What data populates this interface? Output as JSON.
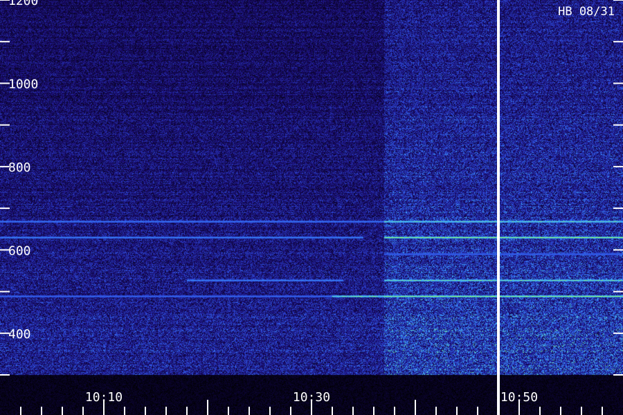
{
  "station_label": "HB 08/31",
  "colors": {
    "background": "#000000",
    "low": "#1a0a6e",
    "mid": "#2e4de0",
    "high": "#3fb8ff",
    "peak": "#9cff3c",
    "tick": "#ffffff",
    "marker": "#ffffff"
  },
  "chart_data": {
    "type": "heatmap",
    "title": "",
    "xlabel": "",
    "ylabel": "",
    "x_range": [
      "10:00",
      "11:00"
    ],
    "ylim": [
      300,
      1200
    ],
    "y_ticks": [
      {
        "value": 1200,
        "label": "1200"
      },
      {
        "value": 1100,
        "label": ""
      },
      {
        "value": 1000,
        "label": "1000"
      },
      {
        "value": 900,
        "label": ""
      },
      {
        "value": 800,
        "label": "800"
      },
      {
        "value": 700,
        "label": ""
      },
      {
        "value": 600,
        "label": "600"
      },
      {
        "value": 500,
        "label": ""
      },
      {
        "value": 400,
        "label": "400"
      },
      {
        "value": 300,
        "label": ""
      }
    ],
    "x_ticks": [
      {
        "value": "10:10",
        "label": "10:10"
      },
      {
        "value": "10:30",
        "label": "10:30"
      },
      {
        "value": "10:50",
        "label": "10:50"
      }
    ],
    "marker_time": "10:48",
    "regime_change_time": "10:37",
    "tone_lines": [
      {
        "freq": 668,
        "start": "10:00",
        "end": "10:37",
        "level": 0.5
      },
      {
        "freq": 668,
        "start": "10:37",
        "end": "11:00",
        "level": 0.85
      },
      {
        "freq": 630,
        "start": "10:00",
        "end": "10:35",
        "level": 0.55
      },
      {
        "freq": 630,
        "start": "10:37",
        "end": "11:00",
        "level": 1.0
      },
      {
        "freq": 590,
        "start": "10:37",
        "end": "11:00",
        "level": 0.45
      },
      {
        "freq": 528,
        "start": "10:18",
        "end": "10:33",
        "level": 0.55
      },
      {
        "freq": 528,
        "start": "10:37",
        "end": "11:00",
        "level": 0.9
      },
      {
        "freq": 490,
        "start": "10:00",
        "end": "10:32",
        "level": 0.45
      },
      {
        "freq": 490,
        "start": "10:32",
        "end": "10:37",
        "level": 0.9
      },
      {
        "freq": 490,
        "start": "10:37",
        "end": "11:00",
        "level": 1.0
      }
    ]
  }
}
